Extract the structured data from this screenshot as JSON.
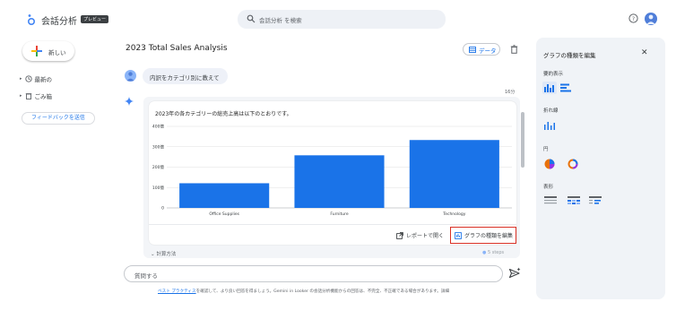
{
  "app": {
    "title": "会話分析",
    "badge": "プレビュー"
  },
  "search": {
    "placeholder": "会話分析 を検索"
  },
  "sidebar": {
    "new_label": "新しい",
    "items": [
      {
        "label": "最新の"
      },
      {
        "label": "ごみ箱"
      }
    ],
    "feedback_label": "フィードバックを送信"
  },
  "conversation": {
    "title": "2023 Total Sales Analysis",
    "data_button_label": "データ",
    "user_message": "内訳をカテゴリ別に教えて",
    "timestamp": "16分",
    "response_text": "2023年の各カテゴリーの総売上高は以下のとおりです。",
    "open_report_label": "レポートで開く",
    "edit_chart_type_label": "グラフの種類を編集",
    "calculation_label": "計算方法",
    "calculation_right": "5 steps"
  },
  "chart_data": {
    "type": "bar",
    "categories": [
      "Office Supplies",
      "Furniture",
      "Technology"
    ],
    "values": [
      121,
      258,
      333
    ],
    "ylim": [
      0,
      400
    ],
    "yticks": [
      0,
      100,
      200,
      300,
      400
    ],
    "ytick_labels": [
      "0",
      "100億",
      "200億",
      "300億",
      "400億"
    ],
    "bar_color": "#1a73e8"
  },
  "prompt": {
    "placeholder": "質問する",
    "disclaimer_link": "ベスト プラクティス",
    "disclaimer_text": "を確認して、より良い回答を得ましょう。Gemini in Looker の会話分析機能からの回答は、不完全、不正確である場合があります。詳細"
  },
  "panel": {
    "title": "グラフの種類を編集",
    "sections": [
      {
        "label": "要約表示"
      },
      {
        "label": "折れ線"
      },
      {
        "label": "円"
      },
      {
        "label": "表形"
      }
    ]
  },
  "colors": {
    "accent": "#1a73e8",
    "highlight": "#d93025",
    "panel": "#f0f3f7"
  }
}
